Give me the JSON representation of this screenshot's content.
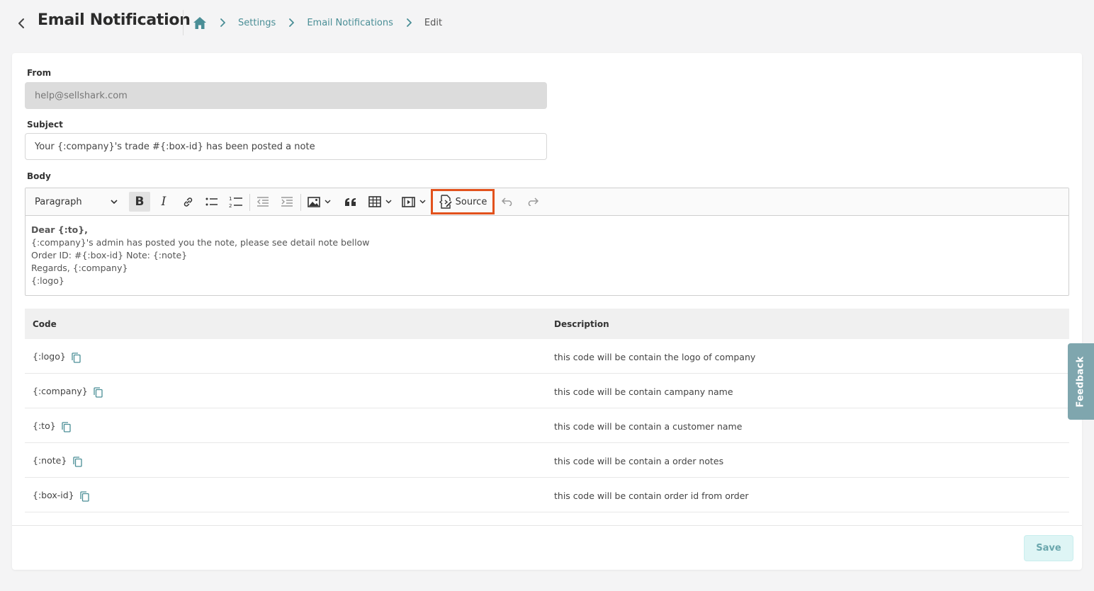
{
  "header": {
    "title": "Email Notification",
    "breadcrumb": [
      "Settings",
      "Email Notifications"
    ],
    "current": "Edit"
  },
  "form": {
    "from_label": "From",
    "from_value": "help@sellshark.com",
    "subject_label": "Subject",
    "subject_value": "Your {:company}'s trade #{:box-id} has been posted a note",
    "body_label": "Body"
  },
  "toolbar": {
    "paragraph": "Paragraph",
    "source": "Source"
  },
  "body_lines": [
    "Dear {:to},",
    "{:company}'s admin has posted you the note, please see detail note bellow",
    "Order ID: #{:box-id} Note: {:note}",
    "Regards, {:company}",
    "{:logo}"
  ],
  "table": {
    "headers": [
      "Code",
      "Description"
    ],
    "rows": [
      {
        "code": "{:logo}",
        "description": "this code will be contain the logo of company"
      },
      {
        "code": "{:company}",
        "description": "this code will be contain campany name"
      },
      {
        "code": "{:to}",
        "description": "this code will be contain a customer name"
      },
      {
        "code": "{:note}",
        "description": "this code will be contain a order notes"
      },
      {
        "code": "{:box-id}",
        "description": "this code will be contain order id from order"
      }
    ]
  },
  "actions": {
    "save": "Save"
  },
  "feedback": "Feedback",
  "colors": {
    "accent": "#4a8e96",
    "highlight": "#e2521d",
    "feedback": "#7fa6ae"
  }
}
